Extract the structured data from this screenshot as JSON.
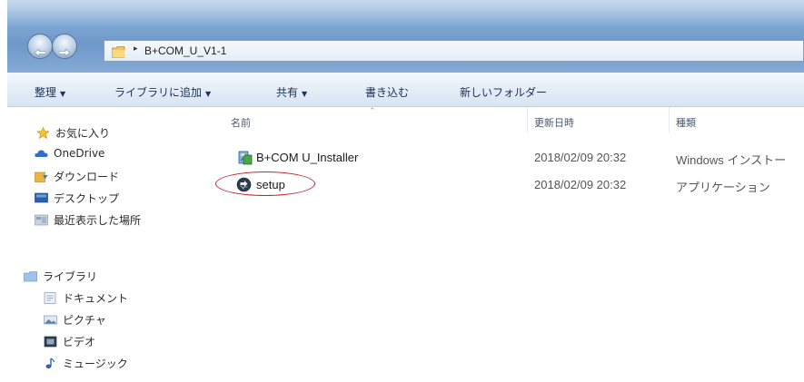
{
  "window": {
    "address": {
      "arrow": "▸",
      "path": "B+COM_U_V1-1"
    }
  },
  "toolbar": {
    "items": [
      {
        "label": "整理",
        "caret": "▼"
      },
      {
        "label": "ライブラリに追加",
        "caret": "▼"
      },
      {
        "label": "共有",
        "caret": "▼"
      },
      {
        "label": "書き込む",
        "caret": ""
      },
      {
        "label": "新しいフォルダー",
        "caret": ""
      }
    ]
  },
  "nav": {
    "favorites": {
      "header": "お気に入り",
      "items": [
        "OneDrive",
        "ダウンロード",
        "デスクトップ",
        "最近表示した場所"
      ]
    },
    "libraries": {
      "header": "ライブラリ",
      "items": [
        "ドキュメント",
        "ピクチャ",
        "ビデオ",
        "ミュージック"
      ]
    }
  },
  "columns": {
    "name": "名前",
    "date": "更新日時",
    "type": "種類"
  },
  "files": [
    {
      "name": "B+COM U_Installer",
      "date": "2018/02/09 20:32",
      "type": "Windows インストー",
      "icon": "installer-icon"
    },
    {
      "name": "setup",
      "date": "2018/02/09 20:32",
      "type": "アプリケーション",
      "icon": "setup-icon"
    }
  ],
  "colors": {
    "highlight": "#c0272d",
    "toolbar_text": "#1e3150"
  }
}
